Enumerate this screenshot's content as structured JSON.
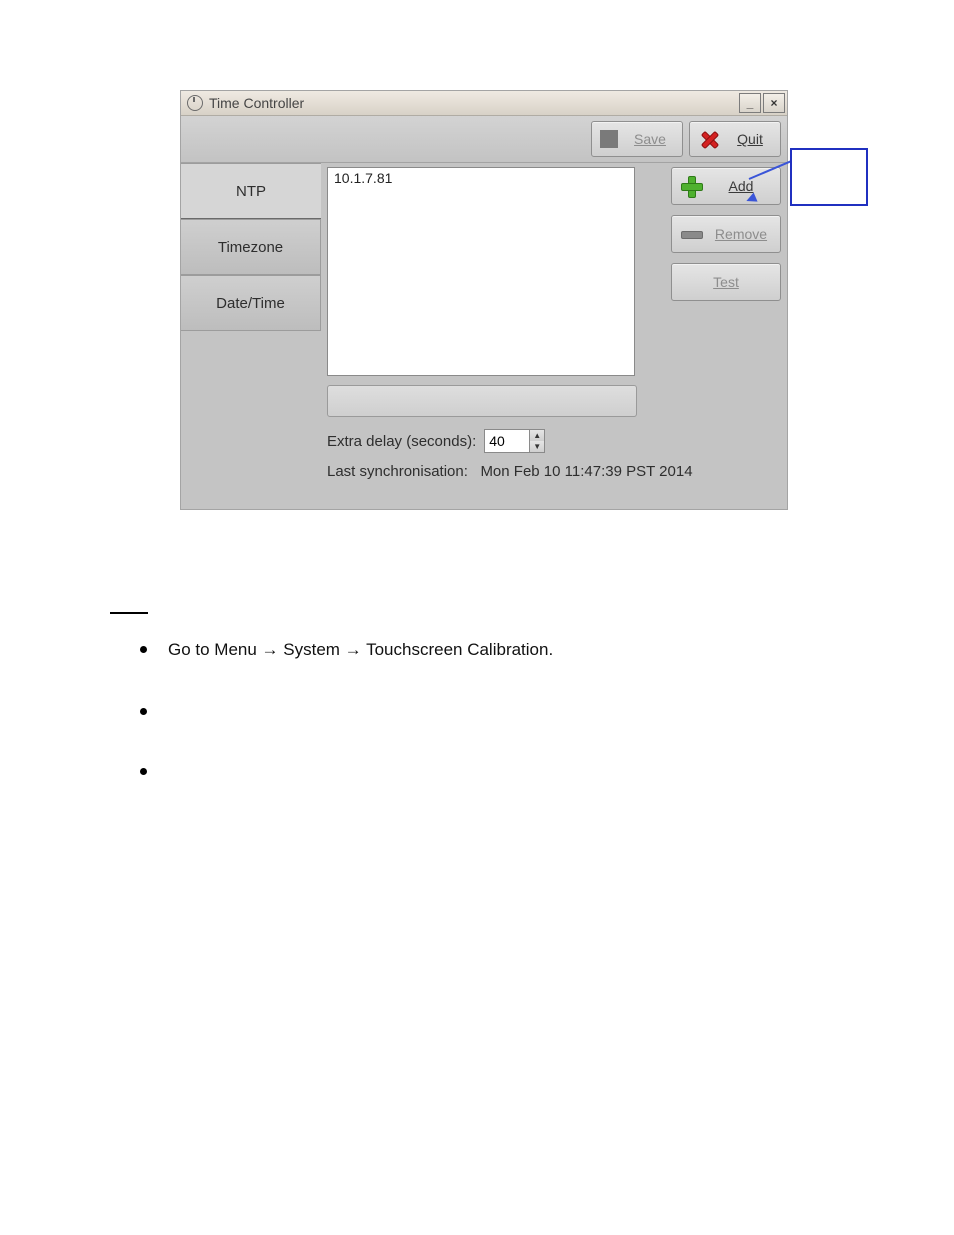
{
  "window": {
    "title": "Time Controller",
    "toolbar": {
      "save_label": "Save",
      "quit_label": "Quit"
    },
    "tabs": {
      "ntp": "NTP",
      "timezone": "Timezone",
      "datetime": "Date/Time"
    },
    "ntp": {
      "server_entry": "10.1.7.81",
      "buttons": {
        "add": "Add",
        "remove": "Remove",
        "test": "Test"
      },
      "delay_label": "Extra delay (seconds):",
      "delay_value": "40",
      "sync_label": "Last synchronisation:",
      "sync_value": "Mon Feb 10 11:47:39 PST 2014"
    }
  },
  "win_buttons": {
    "min": "_",
    "close": "×"
  },
  "doc_bullets": [
    "Go to Menu → System → Touchscreen Calibration.",
    "",
    ""
  ]
}
